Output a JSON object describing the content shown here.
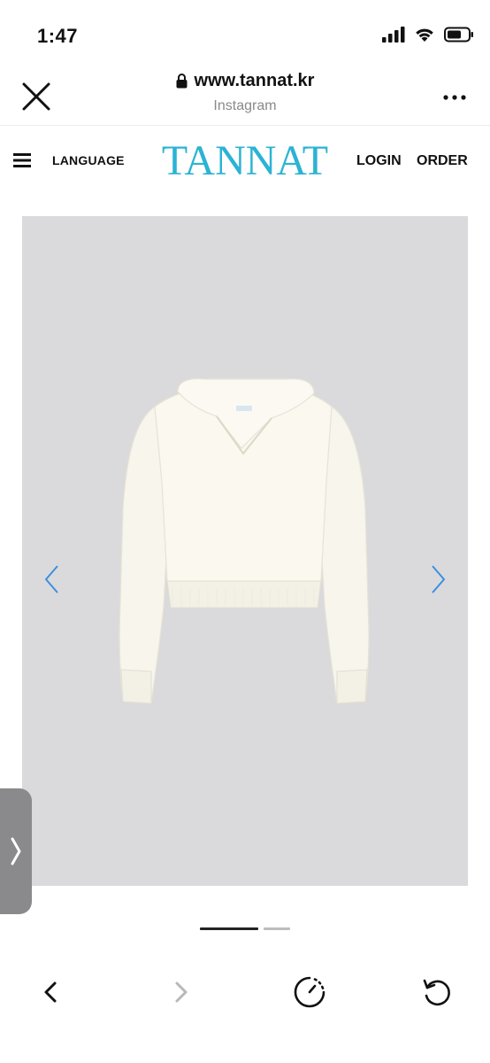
{
  "status_bar": {
    "time": "1:47",
    "icons": [
      "signal-icon",
      "wifi-icon",
      "battery-icon"
    ]
  },
  "browser": {
    "url": "www.tannat.kr",
    "source": "Instagram",
    "icons": [
      "close-icon",
      "lock-icon",
      "more-icon"
    ]
  },
  "site_nav": {
    "language_label": "LANGUAGE",
    "logo_text": "TANNAT",
    "login_label": "LOGIN",
    "order_label": "ORDER",
    "logo_color": "#2bb3d4"
  },
  "product": {
    "image_icon": "hooded-knit-sweater-image",
    "background_color": "#dadadc",
    "arrow_color": "#3d8fe0"
  },
  "carousel": {
    "total_pages": 2,
    "current_page": 1
  },
  "toolbar": {
    "icons": [
      "back-icon",
      "forward-icon",
      "speed-icon",
      "reload-icon"
    ]
  }
}
